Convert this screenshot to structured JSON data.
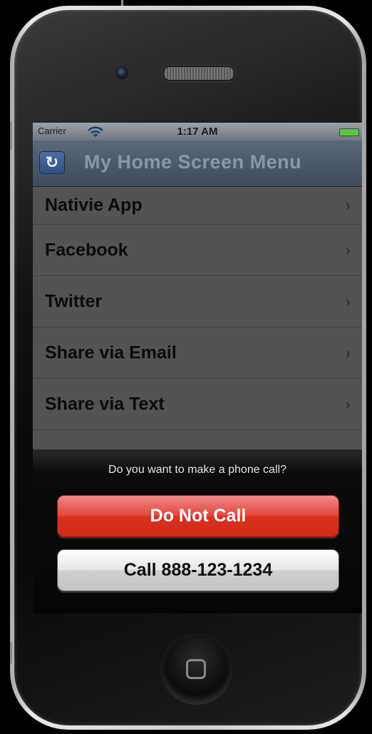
{
  "status_bar": {
    "carrier": "Carrier",
    "time": "1:17 AM",
    "wifi_icon": "wifi-icon",
    "battery_icon": "battery-icon",
    "battery_color": "#58c83a"
  },
  "navbar": {
    "title": "My Home Screen Menu",
    "refresh_glyph": "↻",
    "refresh_icon": "refresh-icon"
  },
  "menu": {
    "items": [
      {
        "label": "Nativie App"
      },
      {
        "label": "Facebook"
      },
      {
        "label": "Twitter"
      },
      {
        "label": "Share via Email"
      },
      {
        "label": "Share via Text"
      }
    ],
    "chevron": "›"
  },
  "action_sheet": {
    "title": "Do you want to make a phone call?",
    "do_not_call_label": "Do Not Call",
    "call_label": "Call 888-123-1234",
    "destructive_color": "#d8301f"
  }
}
